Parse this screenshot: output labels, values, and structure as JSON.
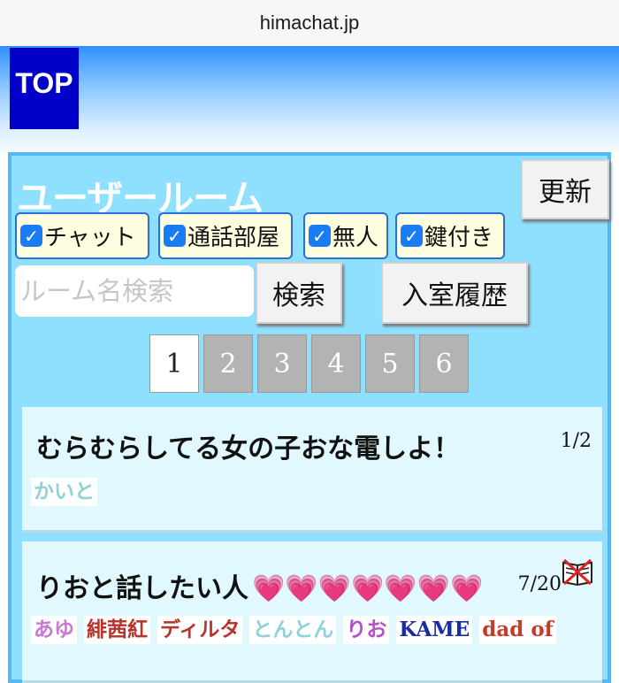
{
  "browser": {
    "url": "himachat.jp"
  },
  "header": {
    "top_label": "TOP"
  },
  "panel": {
    "title": "ユーザールーム",
    "refresh_label": "更新",
    "filters": [
      {
        "label": "チャット",
        "checked": true
      },
      {
        "label": "通話部屋",
        "checked": true
      },
      {
        "label": "無人",
        "checked": true
      },
      {
        "label": "鍵付き",
        "checked": true
      }
    ],
    "search_placeholder": "ルーム名検索",
    "search_label": "検索",
    "history_label": "入室履歴",
    "pages": [
      "1",
      "2",
      "3",
      "4",
      "5",
      "6"
    ],
    "active_page": "1"
  },
  "rooms": [
    {
      "title": "むらむらしてる女の子おな電しよ！",
      "count": "1/2",
      "users": [
        {
          "name": "かいと",
          "color": "#8fd3d8"
        }
      ]
    },
    {
      "title": "りおと話したい人",
      "count": "7/20",
      "hearts": "💗💗💗💗💗💗💗",
      "icon": "no-book-icon",
      "users": [
        {
          "name": "あゆ",
          "color": "#c77ad0"
        },
        {
          "name": "緋茜紅",
          "color": "#b8322a"
        },
        {
          "name": "ディルタ",
          "color": "#b8322a"
        },
        {
          "name": "とんとん",
          "color": "#8fd3d8"
        },
        {
          "name": "りお",
          "color": "#b650c8"
        },
        {
          "name": "KAME",
          "color": "#1a2ca0"
        },
        {
          "name": "dad of",
          "color": "#c63a28"
        }
      ]
    }
  ]
}
